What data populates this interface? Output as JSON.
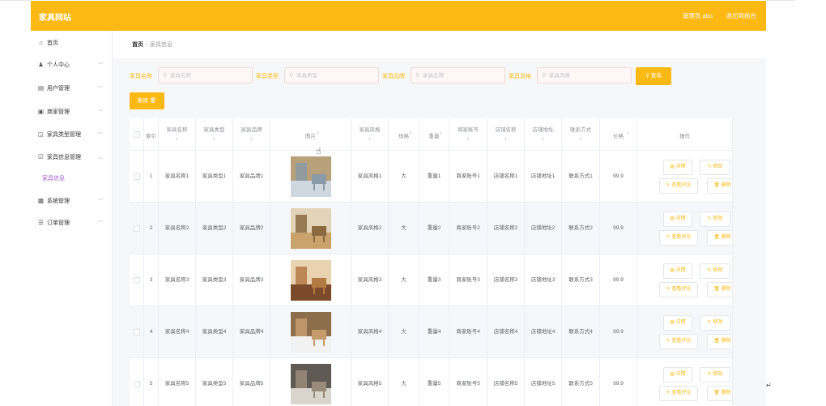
{
  "header": {
    "brand": "家具网站",
    "admin": "管理员 abo",
    "logout": "退出到前台",
    "color": "#fdb913"
  },
  "sidebar": {
    "items": [
      {
        "icon": "home-icon",
        "glyph": "⌂",
        "label": "首页",
        "chevron": false
      },
      {
        "icon": "user-icon",
        "glyph": "♟",
        "label": "个人中心",
        "chevron": true
      },
      {
        "icon": "users-icon",
        "glyph": "▤",
        "label": "用户管理",
        "chevron": true
      },
      {
        "icon": "merchant-icon",
        "glyph": "▣",
        "label": "商家管理",
        "chevron": true
      },
      {
        "icon": "category-icon",
        "glyph": "◲",
        "label": "家具类型管理",
        "chevron": true
      },
      {
        "icon": "furniture-icon",
        "glyph": "☑",
        "label": "家具信息管理",
        "chevron": true,
        "open": true
      },
      {
        "icon": "system-icon",
        "glyph": "▩",
        "label": "系统管理",
        "chevron": true
      },
      {
        "icon": "order-icon",
        "glyph": "☰",
        "label": "订单管理",
        "chevron": true
      }
    ],
    "submenu_active": "家具信息"
  },
  "breadcrumb": {
    "home": "首页",
    "separator": "/",
    "current": "家具信息"
  },
  "filters": [
    {
      "label": "家具名称",
      "placeholder": "家具名称",
      "value": ""
    },
    {
      "label": "家具类型",
      "placeholder": "家具类型",
      "value": ""
    },
    {
      "label": "家具品牌",
      "placeholder": "家具品牌",
      "value": ""
    },
    {
      "label": "家具风格",
      "placeholder": "家具风格",
      "value": ""
    }
  ],
  "search_button": "查询",
  "delete_button": "删除",
  "table": {
    "columns": [
      "",
      "索引",
      "家具名称",
      "家具类型",
      "家具品牌",
      "图片",
      "家具风格",
      "规格",
      "重量",
      "商家账号",
      "店铺名称",
      "店铺地址",
      "联系方式",
      "价格",
      "操作"
    ],
    "sort_glyph": "⇕",
    "actions": {
      "detail": "详情",
      "edit": "修改",
      "review": "查看评论",
      "delete": "删除"
    },
    "rows": [
      {
        "index": "1",
        "name": "家具名称1",
        "type": "家具类型1",
        "brand": "家具品牌1",
        "style": "家具风格1",
        "spec": "大",
        "weight": "重量1",
        "account": "商家账号1",
        "shop": "店铺名称1",
        "address": "店铺地址1",
        "contact": "联系方式1",
        "price": "99.9"
      },
      {
        "index": "2",
        "name": "家具名称2",
        "type": "家具类型2",
        "brand": "家具品牌2",
        "style": "家具风格2",
        "spec": "大",
        "weight": "重量2",
        "account": "商家账号2",
        "shop": "店铺名称2",
        "address": "店铺地址2",
        "contact": "联系方式2",
        "price": "99.9"
      },
      {
        "index": "3",
        "name": "家具名称3",
        "type": "家具类型3",
        "brand": "家具品牌3",
        "style": "家具风格3",
        "spec": "大",
        "weight": "重量3",
        "account": "商家账号3",
        "shop": "店铺名称3",
        "address": "店铺地址3",
        "contact": "联系方式3",
        "price": "99.9"
      },
      {
        "index": "4",
        "name": "家具名称4",
        "type": "家具类型4",
        "brand": "家具品牌4",
        "style": "家具风格4",
        "spec": "大",
        "weight": "重量4",
        "account": "商家账号4",
        "shop": "店铺名称4",
        "address": "店铺地址4",
        "contact": "联系方式4",
        "price": "99.9"
      },
      {
        "index": "5",
        "name": "家具名称5",
        "type": "家具类型5",
        "brand": "家具品牌5",
        "style": "家具风格5",
        "spec": "大",
        "weight": "重量5",
        "account": "商家账号5",
        "shop": "店铺名称5",
        "address": "店铺地址5",
        "contact": "联系方式5",
        "price": "99.9"
      }
    ]
  }
}
